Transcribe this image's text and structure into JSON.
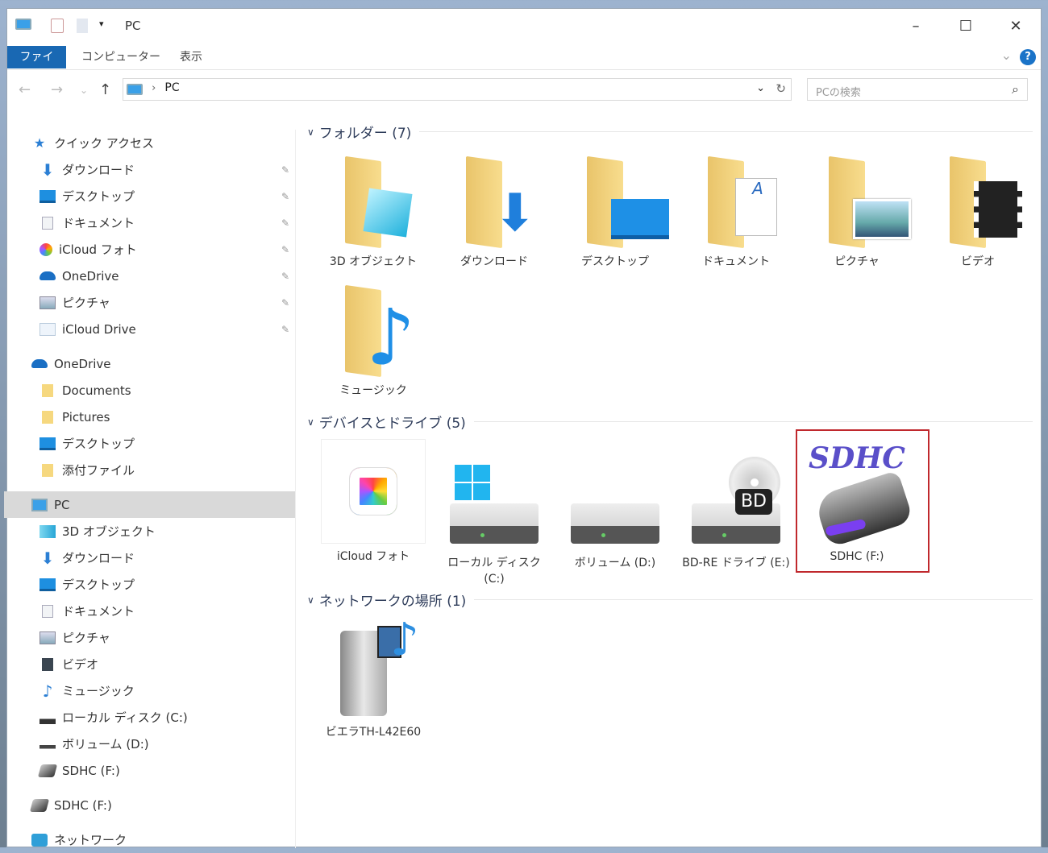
{
  "window": {
    "title": "PC",
    "minimize": "–",
    "maximize": "☐",
    "close": "✕"
  },
  "ribbon": {
    "tabs": [
      "ファイル",
      "コンピューター",
      "表示"
    ],
    "help": "?",
    "expand": "⌄"
  },
  "nav": {
    "back": "←",
    "forward": "→",
    "recent": "⌄",
    "up": "↑",
    "path_sep": "›",
    "path": "PC",
    "dropdown": "⌄",
    "refresh": "↻",
    "search_placeholder": "PCの検索",
    "search_icon": "⌕"
  },
  "sidebar": {
    "pin": "📌",
    "items": [
      {
        "label": "クイック アクセス",
        "level": 1,
        "icon": "star-icon"
      },
      {
        "label": "ダウンロード",
        "level": 2,
        "icon": "download-icon",
        "pinned": true
      },
      {
        "label": "デスクトップ",
        "level": 2,
        "icon": "desktop-icon",
        "pinned": true
      },
      {
        "label": "ドキュメント",
        "level": 2,
        "icon": "document-icon",
        "pinned": true
      },
      {
        "label": "iCloud フォト",
        "level": 2,
        "icon": "photos-icon",
        "pinned": true
      },
      {
        "label": "OneDrive",
        "level": 2,
        "icon": "cloud-icon",
        "pinned": true
      },
      {
        "label": "ピクチャ",
        "level": 2,
        "icon": "pictures-icon",
        "pinned": true
      },
      {
        "label": "iCloud Drive",
        "level": 2,
        "icon": "icloud-drive-icon",
        "pinned": true
      },
      {
        "label": "OneDrive",
        "level": 1,
        "icon": "cloud-icon"
      },
      {
        "label": "Documents",
        "level": 2,
        "icon": "folder-icon"
      },
      {
        "label": "Pictures",
        "level": 2,
        "icon": "folder-icon"
      },
      {
        "label": "デスクトップ",
        "level": 2,
        "icon": "desktop-icon"
      },
      {
        "label": "添付ファイル",
        "level": 2,
        "icon": "folder-icon"
      },
      {
        "label": "PC",
        "level": 1,
        "icon": "pc-icon",
        "selected": true
      },
      {
        "label": "3D オブジェクト",
        "level": 2,
        "icon": "cube-icon"
      },
      {
        "label": "ダウンロード",
        "level": 2,
        "icon": "download-icon"
      },
      {
        "label": "デスクトップ",
        "level": 2,
        "icon": "desktop-icon"
      },
      {
        "label": "ドキュメント",
        "level": 2,
        "icon": "document-icon"
      },
      {
        "label": "ピクチャ",
        "level": 2,
        "icon": "pictures-icon"
      },
      {
        "label": "ビデオ",
        "level": 2,
        "icon": "video-icon"
      },
      {
        "label": "ミュージック",
        "level": 2,
        "icon": "music-icon"
      },
      {
        "label": "ローカル ディスク (C:)",
        "level": 2,
        "icon": "local-disk-icon"
      },
      {
        "label": "ボリューム (D:)",
        "level": 2,
        "icon": "drive-icon"
      },
      {
        "label": "SDHC (F:)",
        "level": 2,
        "icon": "sd-drive-icon"
      },
      {
        "label": "SDHC (F:)",
        "level": 1,
        "icon": "sd-drive-icon"
      },
      {
        "label": "ネットワーク",
        "level": 1,
        "icon": "network-icon"
      }
    ]
  },
  "sections": {
    "folders": {
      "title": "フォルダー (7)",
      "items": [
        "3D オブジェクト",
        "ダウンロード",
        "デスクトップ",
        "ドキュメント",
        "ピクチャ",
        "ビデオ",
        "ミュージック"
      ]
    },
    "devices": {
      "title": "デバイスとドライブ (5)",
      "items": [
        "iCloud フォト",
        "ローカル ディスク (C:)",
        "ボリューム (D:)",
        "BD-RE ドライブ (E:)",
        "SDHC (F:)"
      ],
      "bd_badge": "BD",
      "sdhc_logo": "SDHC"
    },
    "network": {
      "title": "ネットワークの場所 (1)",
      "items": [
        "ビエラTH-L42E60"
      ]
    }
  },
  "colors": {
    "accent": "#1968b3",
    "highlight_box": "#c0282d",
    "folder": "#f2cf72"
  }
}
